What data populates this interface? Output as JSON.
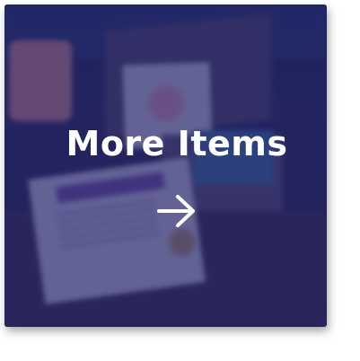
{
  "tile": {
    "label": "More Items",
    "arrow_icon": "arrow-right-icon",
    "overlay_color": "#1e1e5f"
  }
}
